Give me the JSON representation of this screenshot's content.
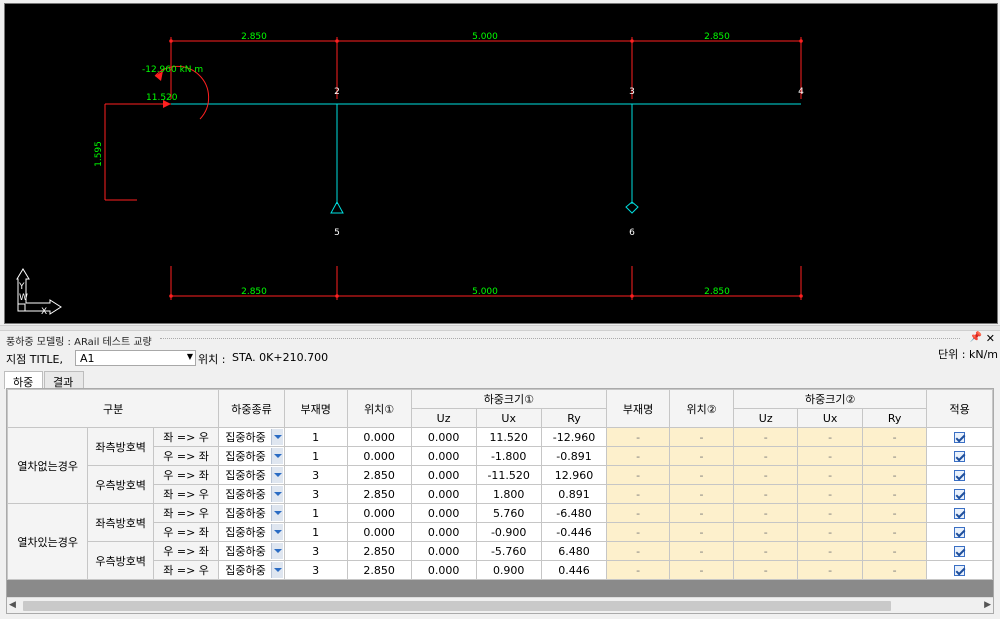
{
  "drawing": {
    "top_dims": [
      "2.850",
      "5.000",
      "2.850"
    ],
    "bottom_dims": [
      "2.850",
      "5.000",
      "2.850"
    ],
    "height_dim": "1.595",
    "moment_label": "-12.960 kN m",
    "force_label": "11.520",
    "node_labels": [
      "2",
      "3",
      "4",
      "5",
      "6"
    ],
    "axis_labels": {
      "y": "Y",
      "x": "X",
      "w": "W"
    },
    "colors": {
      "dim": "#ff2020",
      "dim_text": "#00ff00",
      "member": "#00e0e0",
      "node_text": "#ffffff",
      "moment": "#ff2020"
    }
  },
  "panel": {
    "title": "풍하중 모델링 : ARail 테스트 교량",
    "pin": "📌",
    "close": "✕",
    "unit": "단위 : kN/m"
  },
  "station": {
    "label": "지점 TITLE,",
    "select_value": "A1",
    "location_label": "위치 :",
    "location_value": "STA. 0K+210.700"
  },
  "tabs": [
    {
      "label": "하중",
      "active": true
    },
    {
      "label": "결과",
      "active": false
    }
  ],
  "grid": {
    "headers": {
      "category": "구분",
      "load_type": "하중종류",
      "member1": "부재명",
      "pos1": "위치①",
      "mag1": "하중크기①",
      "member2": "부재명",
      "pos2": "위치②",
      "mag2": "하중크기②",
      "apply": "적용",
      "uz": "Uz",
      "ux": "Ux",
      "ry": "Ry",
      "uz2": "Uz",
      "ux2": "Ux",
      "ry2": "Ry"
    },
    "groups": [
      {
        "label": "열차없는경우",
        "subs": [
          {
            "label": "좌측방호벽"
          },
          {
            "label": "우측방호벽"
          }
        ]
      },
      {
        "label": "열차있는경우",
        "subs": [
          {
            "label": "좌측방호벽"
          },
          {
            "label": "우측방호벽"
          }
        ]
      }
    ],
    "rows": [
      {
        "dir": "좌 => 우",
        "type": "집중하중",
        "member": "1",
        "pos": "0.000",
        "uz": "0.000",
        "ux": "11.520",
        "ry": "-12.960",
        "member2": "-",
        "pos2": "-",
        "uz2": "-",
        "ux2": "-",
        "ry2": "-"
      },
      {
        "dir": "우 => 좌",
        "type": "집중하중",
        "member": "1",
        "pos": "0.000",
        "uz": "0.000",
        "ux": "-1.800",
        "ry": "-0.891",
        "member2": "-",
        "pos2": "-",
        "uz2": "-",
        "ux2": "-",
        "ry2": "-"
      },
      {
        "dir": "우 => 좌",
        "type": "집중하중",
        "member": "3",
        "pos": "2.850",
        "uz": "0.000",
        "ux": "-11.520",
        "ry": "12.960",
        "member2": "-",
        "pos2": "-",
        "uz2": "-",
        "ux2": "-",
        "ry2": "-"
      },
      {
        "dir": "좌 => 우",
        "type": "집중하중",
        "member": "3",
        "pos": "2.850",
        "uz": "0.000",
        "ux": "1.800",
        "ry": "0.891",
        "member2": "-",
        "pos2": "-",
        "uz2": "-",
        "ux2": "-",
        "ry2": "-"
      },
      {
        "dir": "좌 => 우",
        "type": "집중하중",
        "member": "1",
        "pos": "0.000",
        "uz": "0.000",
        "ux": "5.760",
        "ry": "-6.480",
        "member2": "-",
        "pos2": "-",
        "uz2": "-",
        "ux2": "-",
        "ry2": "-"
      },
      {
        "dir": "우 => 좌",
        "type": "집중하중",
        "member": "1",
        "pos": "0.000",
        "uz": "0.000",
        "ux": "-0.900",
        "ry": "-0.446",
        "member2": "-",
        "pos2": "-",
        "uz2": "-",
        "ux2": "-",
        "ry2": "-"
      },
      {
        "dir": "우 => 좌",
        "type": "집중하중",
        "member": "3",
        "pos": "2.850",
        "uz": "0.000",
        "ux": "-5.760",
        "ry": "6.480",
        "member2": "-",
        "pos2": "-",
        "uz2": "-",
        "ux2": "-",
        "ry2": "-"
      },
      {
        "dir": "좌 => 우",
        "type": "집중하중",
        "member": "3",
        "pos": "2.850",
        "uz": "0.000",
        "ux": "0.900",
        "ry": "0.446",
        "member2": "-",
        "pos2": "-",
        "uz2": "-",
        "ux2": "-",
        "ry2": "-"
      }
    ]
  },
  "scrollbar": {
    "left": "◀",
    "right": "▶"
  }
}
